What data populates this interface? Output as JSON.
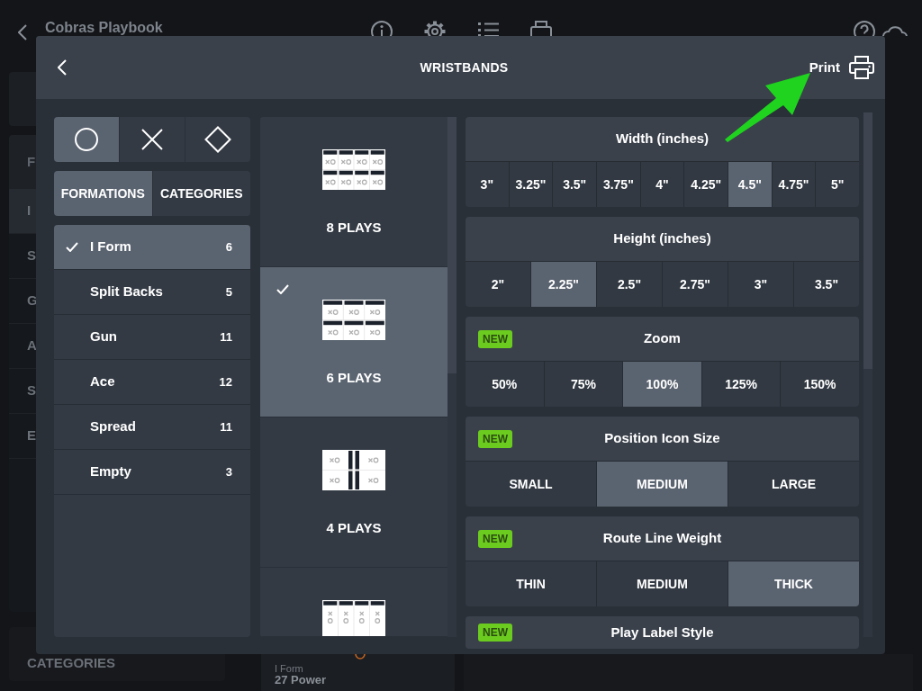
{
  "app": {
    "title": "Cobras Playbook",
    "sidebar": {
      "header": "F",
      "items": [
        {
          "label": "I",
          "selected": true
        },
        {
          "label": "S",
          "selected": false
        },
        {
          "label": "G",
          "selected": false
        },
        {
          "label": "A",
          "selected": false
        },
        {
          "label": "S",
          "selected": false
        },
        {
          "label": "E",
          "selected": false
        }
      ]
    },
    "categories_label": "CATEGORIES",
    "card": {
      "subtitle": "I Form",
      "title": "27 Power"
    }
  },
  "dialog": {
    "title": "WRISTBANDS",
    "print_label": "Print"
  },
  "shapes": [
    {
      "kind": "circle",
      "selected": true
    },
    {
      "kind": "cross",
      "selected": false
    },
    {
      "kind": "diamond",
      "selected": false
    }
  ],
  "tabs": [
    {
      "label": "FORMATIONS",
      "selected": true
    },
    {
      "label": "CATEGORIES",
      "selected": false
    }
  ],
  "formations": [
    {
      "name": "I Form",
      "count": "6",
      "selected": true
    },
    {
      "name": "Split Backs",
      "count": "5",
      "selected": false
    },
    {
      "name": "Gun",
      "count": "11",
      "selected": false
    },
    {
      "name": "Ace",
      "count": "12",
      "selected": false
    },
    {
      "name": "Spread",
      "count": "11",
      "selected": false
    },
    {
      "name": "Empty",
      "count": "3",
      "selected": false
    }
  ],
  "layouts": [
    {
      "kind": "grid8",
      "label": "8 PLAYS",
      "selected": false
    },
    {
      "kind": "grid6",
      "label": "6 PLAYS",
      "selected": true
    },
    {
      "kind": "split4",
      "label": "4 PLAYS",
      "selected": false
    },
    {
      "kind": "column4",
      "selected": false
    }
  ],
  "settings": [
    {
      "title": "Width (inches)",
      "options": [
        {
          "label": "3\"",
          "selected": false
        },
        {
          "label": "3.25\"",
          "selected": false
        },
        {
          "label": "3.5\"",
          "selected": false
        },
        {
          "label": "3.75\"",
          "selected": false
        },
        {
          "label": "4\"",
          "selected": false
        },
        {
          "label": "4.25\"",
          "selected": false
        },
        {
          "label": "4.5\"",
          "selected": true
        },
        {
          "label": "4.75\"",
          "selected": false
        },
        {
          "label": "5\"",
          "selected": false
        }
      ]
    },
    {
      "title": "Height (inches)",
      "options": [
        {
          "label": "2\"",
          "selected": false
        },
        {
          "label": "2.25\"",
          "selected": true
        },
        {
          "label": "2.5\"",
          "selected": false
        },
        {
          "label": "2.75\"",
          "selected": false
        },
        {
          "label": "3\"",
          "selected": false
        },
        {
          "label": "3.5\"",
          "selected": false
        }
      ]
    },
    {
      "title": "Zoom",
      "badge": "NEW",
      "options": [
        {
          "label": "50%",
          "selected": false
        },
        {
          "label": "75%",
          "selected": false
        },
        {
          "label": "100%",
          "selected": true
        },
        {
          "label": "125%",
          "selected": false
        },
        {
          "label": "150%",
          "selected": false
        }
      ]
    },
    {
      "title": "Position Icon Size",
      "badge": "NEW",
      "options": [
        {
          "label": "SMALL",
          "selected": false
        },
        {
          "label": "MEDIUM",
          "selected": true
        },
        {
          "label": "LARGE",
          "selected": false
        }
      ]
    },
    {
      "title": "Route Line Weight",
      "badge": "NEW",
      "options": [
        {
          "label": "THIN",
          "selected": false
        },
        {
          "label": "MEDIUM",
          "selected": false
        },
        {
          "label": "THICK",
          "selected": true
        }
      ]
    },
    {
      "title": "Play Label Style",
      "badge": "NEW"
    }
  ],
  "annotations": [
    {
      "kind": "arrow"
    }
  ]
}
